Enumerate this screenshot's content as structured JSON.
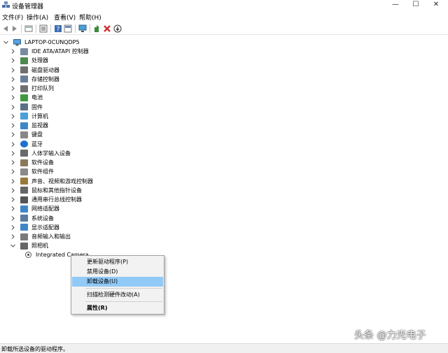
{
  "window": {
    "title": "设备管理器",
    "minimize": "—",
    "maximize": "☐",
    "close": "✕"
  },
  "menu": [
    "文件(F)",
    "操作(A)",
    "查看(V)",
    "帮助(H)"
  ],
  "toolbar": {
    "icons": [
      "back-icon",
      "forward-icon",
      "properties-icon",
      "view-icon",
      "help-icon",
      "action-icon",
      "monitor-icon",
      "update-driver-icon",
      "uninstall-icon",
      "disable-icon"
    ]
  },
  "tree": {
    "root": "LAPTOP-0CUNQDP5",
    "categories": [
      "IDE ATA/ATAPI 控制器",
      "处理器",
      "磁盘驱动器",
      "存储控制器",
      "打印队列",
      "电池",
      "固件",
      "计算机",
      "监视器",
      "键盘",
      "蓝牙",
      "人体学输入设备",
      "软件设备",
      "软件组件",
      "声音、视频和游戏控制器",
      "鼠标和其他指针设备",
      "通用串行总线控制器",
      "网络适配器",
      "系统设备",
      "显示适配器",
      "音频输入和输出",
      "照相机"
    ],
    "camera_device": "Integrated Camera"
  },
  "context_menu": {
    "items": [
      "更新驱动程序(P)",
      "禁用设备(D)",
      "卸载设备(U)",
      "扫描检测硬件改动(A)",
      "属性(R)"
    ]
  },
  "status": "卸载所选设备的驱动程序。",
  "watermark": "头条 @力光电子",
  "colors": {
    "highlight": "#91c9f7",
    "delete_red": "#d32f2f"
  }
}
